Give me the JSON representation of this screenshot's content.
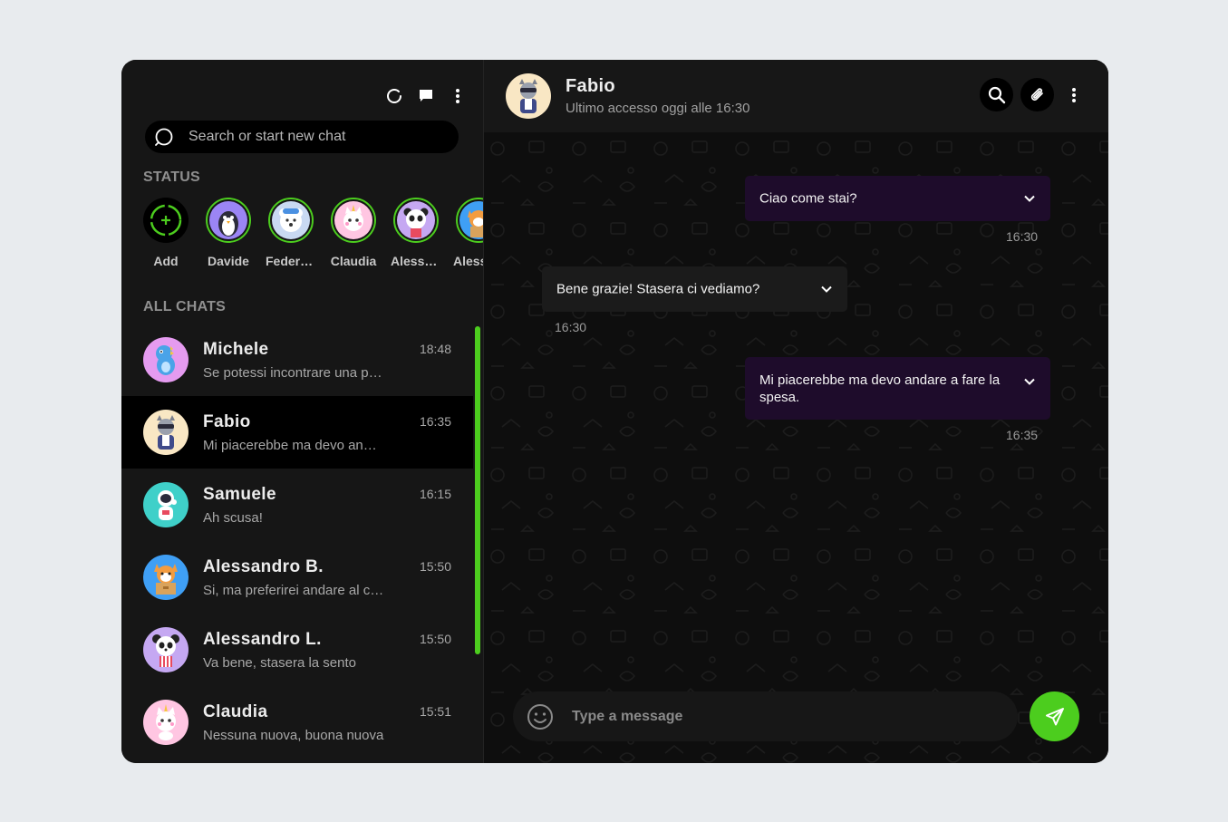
{
  "sidebar": {
    "search": {
      "placeholder": "Search or start new chat"
    },
    "status_title": "STATUS",
    "status_items": [
      {
        "name": "Add",
        "type": "add"
      },
      {
        "name": "Davide",
        "avatar": "penguin",
        "color": "#9b85f4"
      },
      {
        "name": "Federico",
        "avatar": "polar-bear",
        "color": "#c9d9f2"
      },
      {
        "name": "Claudia",
        "avatar": "cat-unicorn",
        "color": "#ffc6e2"
      },
      {
        "name": "Alessandro L.",
        "avatar": "panda",
        "color": "#c5a8f2"
      },
      {
        "name": "Alessandro B.",
        "avatar": "fox-box",
        "color": "#3f9ff5"
      }
    ],
    "chats_title": "ALL CHATS",
    "chats": [
      {
        "name": "Michele",
        "preview": "Se potessi incontrare una persona famosa chi sarebbe?",
        "time": "18:48",
        "avatar": "dinosaur",
        "color": "#e59bf0",
        "active": false
      },
      {
        "name": "Fabio",
        "preview": "Mi piacerebbe ma devo andare a fare la spesa.",
        "time": "16:35",
        "avatar": "raccoon",
        "color": "#f9e7c4",
        "active": true
      },
      {
        "name": "Samuele",
        "preview": "Ah scusa!",
        "time": "16:15",
        "avatar": "astronaut",
        "color": "#3fd0c9",
        "active": false
      },
      {
        "name": "Alessandro B.",
        "preview": "Si, ma preferirei andare al cinema",
        "time": "15:50",
        "avatar": "fox-box",
        "color": "#3f9ff5",
        "active": false
      },
      {
        "name": "Alessandro L.",
        "preview": "Va bene, stasera la sento",
        "time": "15:50",
        "avatar": "panda",
        "color": "#c5a8f2",
        "active": false
      },
      {
        "name": "Claudia",
        "preview": "Nessuna nuova, buona nuova",
        "time": "15:51",
        "avatar": "cat-unicorn",
        "color": "#ffc6e2",
        "active": false
      }
    ],
    "icons": [
      "refresh-icon",
      "chat-bubble-icon",
      "more-vertical-icon"
    ]
  },
  "conversation": {
    "contact_name": "Fabio",
    "contact_status": "Ultimo accesso oggi alle 16:30",
    "contact_avatar": "raccoon",
    "messages": [
      {
        "text": "Ciao come stai?",
        "time": "16:30",
        "direction": "out"
      },
      {
        "text": "Bene grazie! Stasera ci vediamo?",
        "time": "16:30",
        "direction": "in"
      },
      {
        "text": "Mi piacerebbe ma devo andare a fare la spesa.",
        "time": "16:35",
        "direction": "out"
      }
    ],
    "composer": {
      "placeholder": "Type a message"
    }
  },
  "colors": {
    "accent": "#4ccd1e",
    "outgoing_bubble": "#1e0c2b",
    "incoming_bubble": "#1b1b1b",
    "sidebar_bg": "#161616",
    "active_chat_bg": "#000000"
  }
}
